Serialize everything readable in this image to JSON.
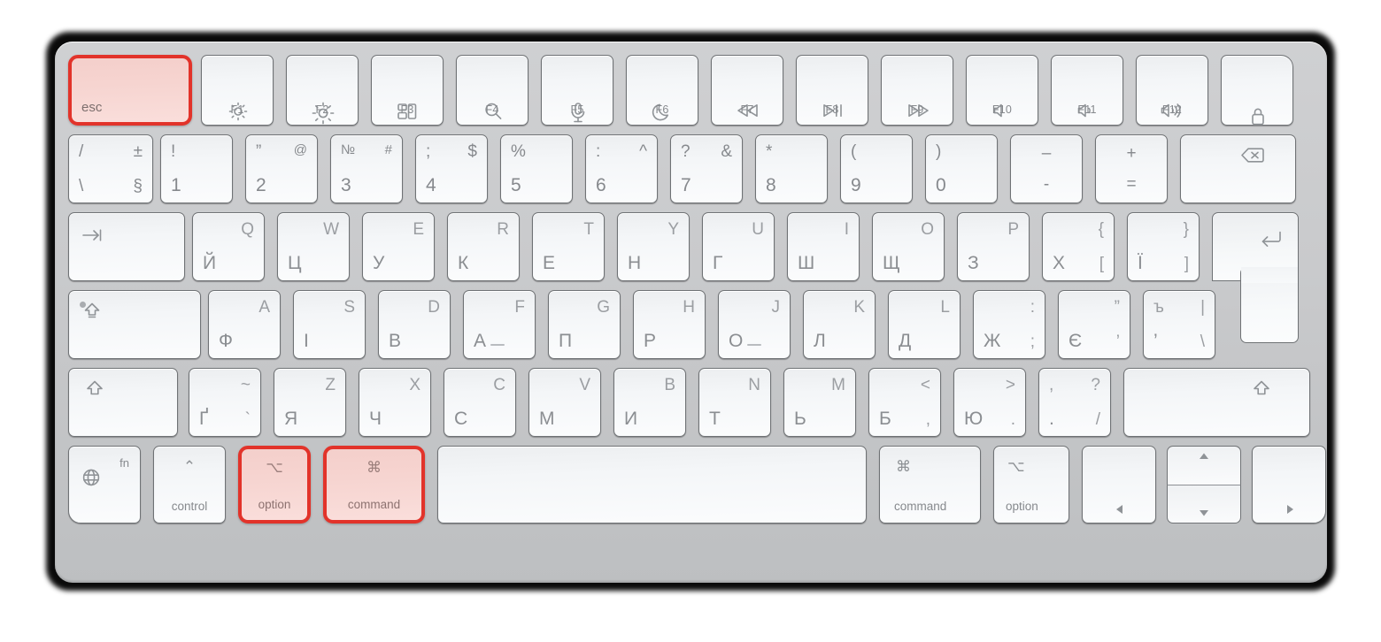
{
  "device": {
    "name": "Apple Magic Keyboard",
    "layout": "Ukrainian / Cyrillic",
    "highlight_color": "#e2332a",
    "highlight_fill": "#f6d4d0",
    "body_color": "#c9cacc",
    "key_color": "#f6f8f9",
    "legend_color": "#8b8e92"
  },
  "highlighted_keys": [
    "esc",
    "option",
    "command"
  ],
  "rows": {
    "function_row": [
      {
        "name": "esc",
        "label": "esc",
        "icon": "",
        "highlighted": true
      },
      {
        "name": "f1",
        "label": "F1",
        "icon": "brightness-low-icon"
      },
      {
        "name": "f2",
        "label": "F2",
        "icon": "brightness-high-icon"
      },
      {
        "name": "f3",
        "label": "F3",
        "icon": "mission-control-icon"
      },
      {
        "name": "f4",
        "label": "F4",
        "icon": "spotlight-search-icon"
      },
      {
        "name": "f5",
        "label": "F5",
        "icon": "microphone-dictation-icon"
      },
      {
        "name": "f6",
        "label": "F6",
        "icon": "do-not-disturb-moon-icon"
      },
      {
        "name": "f7",
        "label": "F7",
        "icon": "rewind-icon"
      },
      {
        "name": "f8",
        "label": "F8",
        "icon": "play-pause-icon"
      },
      {
        "name": "f9",
        "label": "F9",
        "icon": "fast-forward-icon"
      },
      {
        "name": "f10",
        "label": "F10",
        "icon": "mute-icon"
      },
      {
        "name": "f11",
        "label": "F11",
        "icon": "volume-down-icon"
      },
      {
        "name": "f12",
        "label": "F12",
        "icon": "volume-up-icon"
      },
      {
        "name": "touch-id",
        "label": "",
        "icon": "lock-touchid-icon"
      }
    ],
    "number_row": [
      {
        "name": "key-slash-backslash",
        "top_left": "/",
        "top_right": "±",
        "bottom_left": "\\",
        "bottom_right": "§"
      },
      {
        "name": "key-1",
        "top_left": "!",
        "bottom_left": "1"
      },
      {
        "name": "key-2",
        "top_left": "”",
        "top_right": "@",
        "bottom_left": "2"
      },
      {
        "name": "key-3",
        "top_left": "№",
        "top_right": "#",
        "bottom_left": "3"
      },
      {
        "name": "key-4",
        "top_left": ";",
        "top_right": "$",
        "bottom_left": "4"
      },
      {
        "name": "key-5",
        "top_left": "%",
        "bottom_left": "5"
      },
      {
        "name": "key-6",
        "top_left": ":",
        "top_right": "^",
        "bottom_left": "6"
      },
      {
        "name": "key-7",
        "top_left": "?",
        "top_right": "&",
        "bottom_left": "7"
      },
      {
        "name": "key-8",
        "top_left": "*",
        "bottom_left": "8"
      },
      {
        "name": "key-9",
        "top_left": "(",
        "bottom_left": "9"
      },
      {
        "name": "key-0",
        "top_left": ")",
        "bottom_left": "0"
      },
      {
        "name": "key-minus",
        "top_center": "–",
        "bottom_center": "-"
      },
      {
        "name": "key-equal",
        "top_center": "+",
        "bottom_center": "="
      },
      {
        "name": "delete",
        "icon": "delete-backspace-icon"
      }
    ],
    "top_letter_row": [
      {
        "name": "tab",
        "icon": "tab-arrow-icon"
      },
      {
        "name": "key-q",
        "cyrillic": "Й",
        "latin": "Q"
      },
      {
        "name": "key-w",
        "cyrillic": "Ц",
        "latin": "W"
      },
      {
        "name": "key-e",
        "cyrillic": "У",
        "latin": "E"
      },
      {
        "name": "key-r",
        "cyrillic": "К",
        "latin": "R"
      },
      {
        "name": "key-t",
        "cyrillic": "Е",
        "latin": "T"
      },
      {
        "name": "key-y",
        "cyrillic": "Н",
        "latin": "Y"
      },
      {
        "name": "key-u",
        "cyrillic": "Г",
        "latin": "U"
      },
      {
        "name": "key-i",
        "cyrillic": "Ш",
        "latin": "I"
      },
      {
        "name": "key-o",
        "cyrillic": "Щ",
        "latin": "O"
      },
      {
        "name": "key-p",
        "cyrillic": "З",
        "latin": "P"
      },
      {
        "name": "key-bracket-left",
        "cyrillic": "Х",
        "latin": "[",
        "top_right": "{"
      },
      {
        "name": "key-bracket-right",
        "cyrillic": "Ї",
        "latin": "]",
        "top_right": "}"
      },
      {
        "name": "return",
        "icon": "return-enter-icon"
      }
    ],
    "home_row": [
      {
        "name": "caps-lock",
        "icon": "caps-lock-arrow-icon",
        "indicator": true
      },
      {
        "name": "key-a",
        "cyrillic": "Ф",
        "latin": "A"
      },
      {
        "name": "key-s",
        "cyrillic": "І",
        "latin": "S"
      },
      {
        "name": "key-d",
        "cyrillic": "В",
        "latin": "D"
      },
      {
        "name": "key-f",
        "cyrillic": "А",
        "latin": "F",
        "home_bump": true
      },
      {
        "name": "key-g",
        "cyrillic": "П",
        "latin": "G"
      },
      {
        "name": "key-h",
        "cyrillic": "Р",
        "latin": "H"
      },
      {
        "name": "key-j",
        "cyrillic": "О",
        "latin": "J",
        "home_bump": true
      },
      {
        "name": "key-k",
        "cyrillic": "Л",
        "latin": "K"
      },
      {
        "name": "key-l",
        "cyrillic": "Д",
        "latin": "L"
      },
      {
        "name": "key-semicolon",
        "cyrillic": "Ж",
        "latin": ";",
        "top_right": ":"
      },
      {
        "name": "key-quote",
        "cyrillic": "Є",
        "latin": "’",
        "top_right": "”"
      },
      {
        "name": "key-backslash",
        "cyrillic": "’",
        "top_left": "ъ",
        "latin": "\\",
        "top_right": "|"
      }
    ],
    "bottom_letter_row": [
      {
        "name": "shift-left",
        "icon": "shift-arrow-icon"
      },
      {
        "name": "key-grave",
        "cyrillic": "Ґ",
        "latin": "`",
        "top_right": "~"
      },
      {
        "name": "key-z",
        "cyrillic": "Я",
        "latin": "Z"
      },
      {
        "name": "key-x",
        "cyrillic": "Ч",
        "latin": "X"
      },
      {
        "name": "key-c",
        "cyrillic": "С",
        "latin": "C"
      },
      {
        "name": "key-v",
        "cyrillic": "М",
        "latin": "V"
      },
      {
        "name": "key-b",
        "cyrillic": "И",
        "latin": "B"
      },
      {
        "name": "key-n",
        "cyrillic": "Т",
        "latin": "N"
      },
      {
        "name": "key-m",
        "cyrillic": "Ь",
        "latin": "M"
      },
      {
        "name": "key-comma",
        "cyrillic": "Б",
        "latin": ",",
        "top_right": "<"
      },
      {
        "name": "key-period",
        "cyrillic": "Ю",
        "latin": ".",
        "top_right": ">"
      },
      {
        "name": "key-slash",
        "cyrillic": ".",
        "top_left": ",",
        "latin": "/",
        "top_right": "?"
      },
      {
        "name": "shift-right",
        "icon": "shift-arrow-icon"
      }
    ],
    "modifier_row": [
      {
        "name": "fn-globe",
        "label": "fn",
        "icon": "globe-icon"
      },
      {
        "name": "control",
        "label": "control",
        "glyph": "⌃"
      },
      {
        "name": "option-left",
        "label": "option",
        "glyph": "⌥",
        "highlighted": true
      },
      {
        "name": "command-left",
        "label": "command",
        "glyph": "⌘",
        "highlighted": true
      },
      {
        "name": "space",
        "label": ""
      },
      {
        "name": "command-right",
        "label": "command",
        "glyph": "⌘"
      },
      {
        "name": "option-right",
        "label": "option",
        "glyph": "⌥"
      },
      {
        "name": "arrow-left",
        "icon": "arrow-left-icon"
      },
      {
        "name": "arrow-up-down",
        "icon_up": "arrow-up-icon",
        "icon_down": "arrow-down-icon"
      },
      {
        "name": "arrow-right",
        "icon": "arrow-right-icon"
      }
    ]
  }
}
